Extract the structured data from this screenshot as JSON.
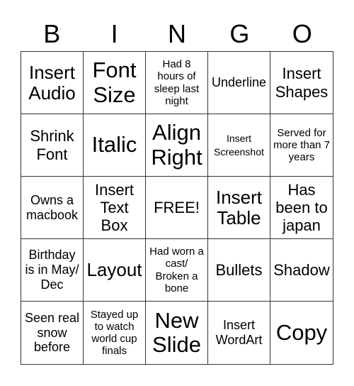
{
  "header": {
    "letters": [
      "B",
      "I",
      "N",
      "G",
      "O"
    ]
  },
  "board": {
    "cells": [
      "Insert Audio",
      "Font Size",
      "Had 8 hours of sleep last night",
      "Underline",
      "Insert Shapes",
      "Shrink Font",
      "Italic",
      "Align Right",
      "Insert Screenshot",
      "Served for more than 7 years",
      "Owns a macbook",
      "Insert Text Box",
      "FREE!",
      "Insert Table",
      "Has been to japan",
      "Birthday is in May/ Dec",
      "Layout",
      "Had worn a cast/ Broken a bone",
      "Bullets",
      "Shadow",
      "Seen real snow before",
      "Stayed up to watch world cup finals",
      "New Slide",
      "Insert WordArt",
      "Copy"
    ]
  }
}
